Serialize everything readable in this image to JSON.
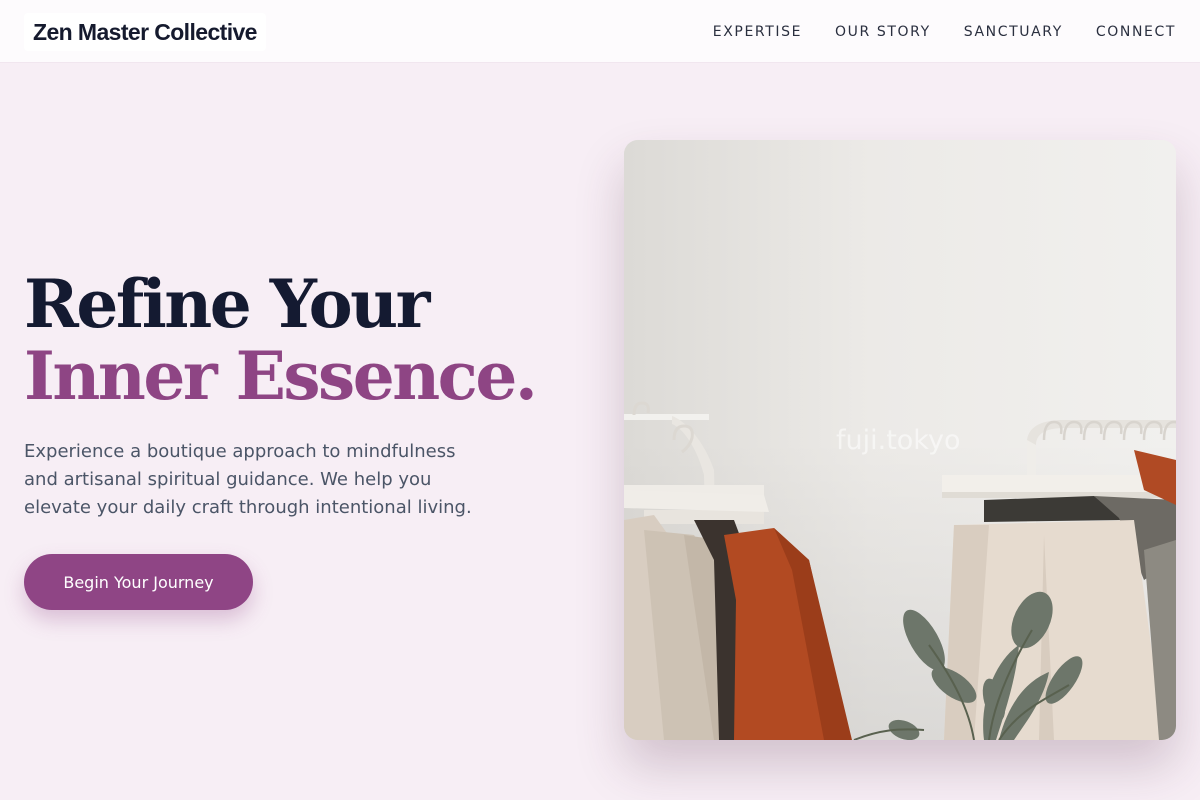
{
  "header": {
    "logo": "Zen Master Collective",
    "nav": [
      "EXPERTISE",
      "OUR STORY",
      "SANCTUARY",
      "CONNECT"
    ]
  },
  "hero": {
    "headline_line1": "Refine Your",
    "headline_line2": "Inner Essence.",
    "lead": "Experience a boutique approach to mindfulness and artisanal spiritual guidance. We help you elevate your daily craft through intentional living.",
    "cta": "Begin Your Journey",
    "image_watermark": "fuji.tokyo"
  },
  "colors": {
    "page_bg": "#f7eef5",
    "accent": "#8f4585",
    "headline_dark": "#141a31",
    "body_text": "#4b5567"
  }
}
